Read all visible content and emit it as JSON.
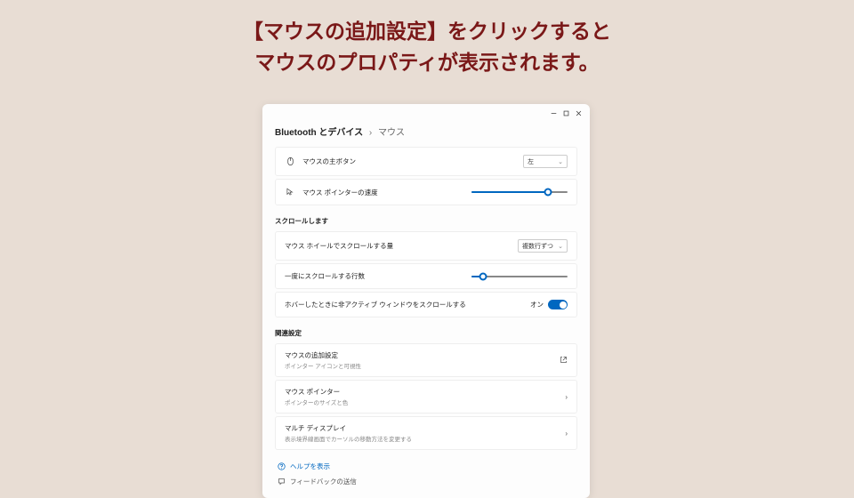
{
  "annotation": {
    "line1": "【マウスの追加設定】をクリックすると",
    "line2": "マウスのプロパティが表示されます。"
  },
  "breadcrumb": {
    "parent": "Bluetooth とデバイス",
    "sep": "›",
    "current": "マウス"
  },
  "primary_button": {
    "label": "マウスの主ボタン",
    "value": "左"
  },
  "pointer_speed": {
    "label": "マウス ポインターの速度",
    "percent": 80
  },
  "scroll_section": {
    "title": "スクロールします",
    "wheel": {
      "label": "マウス ホイールでスクロールする量",
      "value": "複数行ずつ"
    },
    "lines": {
      "label": "一度にスクロールする行数",
      "percent": 12
    },
    "hover": {
      "label": "ホバーしたときに非アクティブ ウィンドウをスクロールする",
      "state_label": "オン"
    }
  },
  "related": {
    "title": "関連設定",
    "items": [
      {
        "title": "マウスの追加設定",
        "sub": "ポインター アイコンと可視性",
        "type": "external"
      },
      {
        "title": "マウス ポインター",
        "sub": "ポインターのサイズと色",
        "type": "nav"
      },
      {
        "title": "マルチ ディスプレイ",
        "sub": "表示境界線画面でカーソルの移動方法を変更する",
        "type": "nav"
      }
    ]
  },
  "help": {
    "help_label": "ヘルプを表示",
    "feedback_label": "フィードバックの送信"
  }
}
